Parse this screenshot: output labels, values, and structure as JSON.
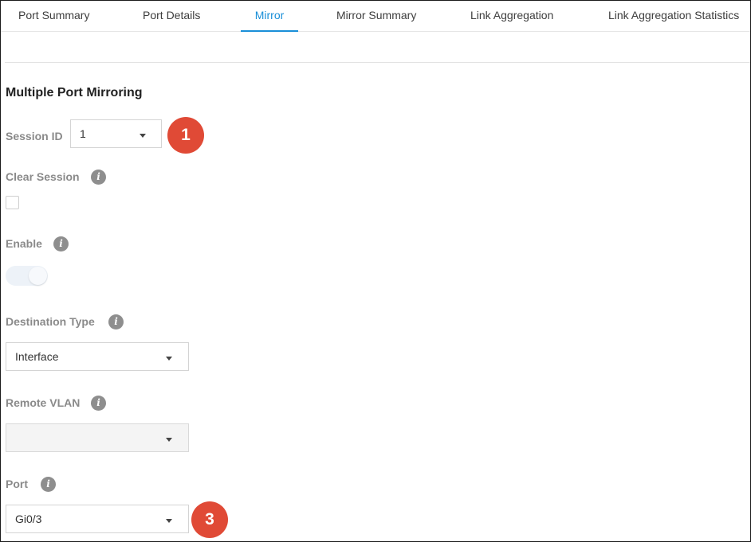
{
  "tabs": [
    {
      "label": "Port Summary"
    },
    {
      "label": "Port Details"
    },
    {
      "label": "Mirror",
      "active": true
    },
    {
      "label": "Mirror Summary"
    },
    {
      "label": "Link Aggregation"
    },
    {
      "label": "Link Aggregation Statistics"
    }
  ],
  "section_title": "Multiple Port Mirroring",
  "session_id": {
    "label": "Session ID",
    "value": "1"
  },
  "clear_session": {
    "label": "Clear Session",
    "checked": false,
    "info_icon": "info-icon"
  },
  "enable": {
    "label": "Enable",
    "on": false,
    "info_icon": "info-icon"
  },
  "destination_type": {
    "label": "Destination Type",
    "value": "Interface",
    "info_icon": "info-icon"
  },
  "remote_vlan": {
    "label": "Remote VLAN",
    "value": "",
    "disabled": true,
    "info_icon": "info-icon"
  },
  "port": {
    "label": "Port",
    "value": "Gi0/3",
    "info_icon": "info-icon"
  },
  "callouts": [
    {
      "number": "1"
    },
    {
      "number": "3"
    }
  ],
  "colors": {
    "accent": "#1a8fd8",
    "callout": "#e04a36",
    "label": "#8a8a8a"
  }
}
